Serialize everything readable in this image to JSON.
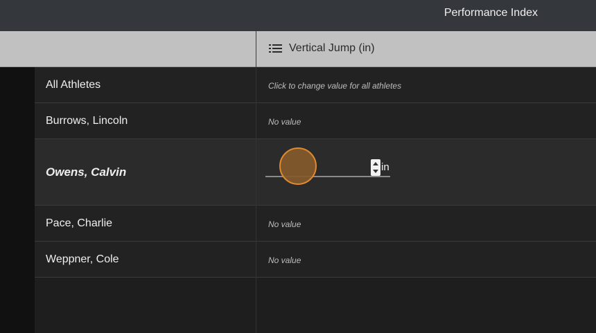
{
  "header": {
    "title": "Performance Index"
  },
  "column": {
    "title": "Vertical Jump (in)",
    "icon": "list-icon"
  },
  "rows": [
    {
      "name": "All Athletes",
      "value": "Click to change value for all athletes"
    },
    {
      "name": "Burrows, Lincoln",
      "value": "No value"
    },
    {
      "name": "Owens, Calvin",
      "value": ""
    },
    {
      "name": "Pace, Charlie",
      "value": "No value"
    },
    {
      "name": "Weppner, Cole",
      "value": "No value"
    }
  ],
  "editor": {
    "unit": "in",
    "value": ""
  },
  "colors": {
    "accent": "#e08a2e",
    "header_bg": "#c1c1c1",
    "topbar_bg": "#34373c"
  }
}
